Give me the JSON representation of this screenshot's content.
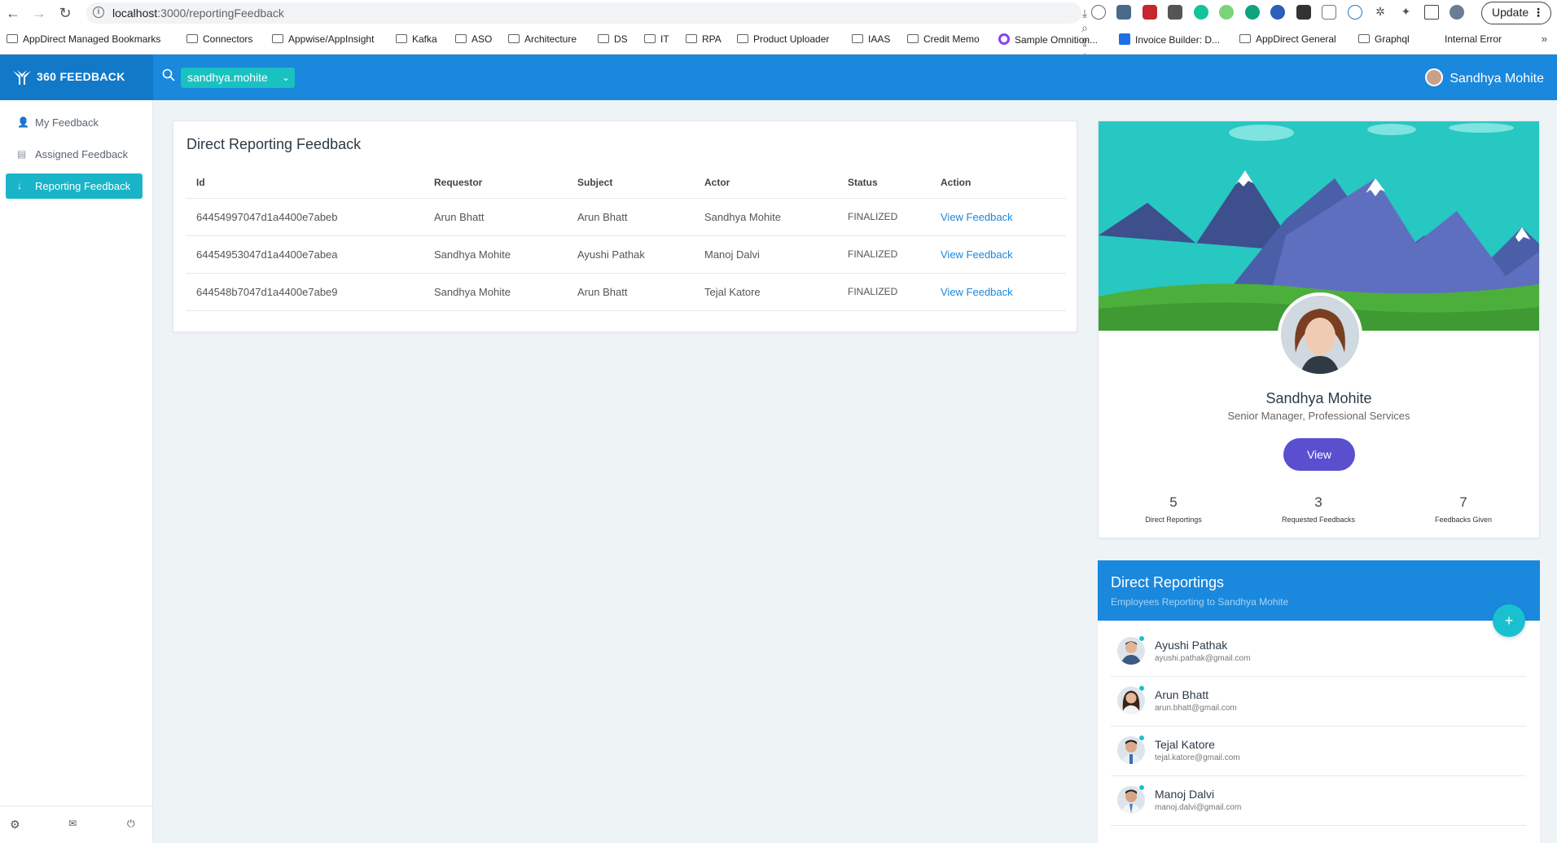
{
  "browser": {
    "url_host": "localhost",
    "url_path": ":3000/reportingFeedback",
    "update_label": "Update",
    "bookmarks": [
      {
        "label": "AppDirect Managed Bookmarks"
      },
      {
        "label": "Connectors"
      },
      {
        "label": "Appwise/AppInsight"
      },
      {
        "label": "Kafka"
      },
      {
        "label": "ASO"
      },
      {
        "label": "Architecture"
      },
      {
        "label": "DS"
      },
      {
        "label": "IT"
      },
      {
        "label": "RPA"
      },
      {
        "label": "Product Uploader"
      },
      {
        "label": "IAAS"
      },
      {
        "label": "Credit Memo"
      },
      {
        "label": "Sample Omnition..."
      },
      {
        "label": "Invoice Builder: D..."
      },
      {
        "label": "AppDirect General"
      },
      {
        "label": "Graphql"
      },
      {
        "label": "Internal Error"
      }
    ],
    "more": "»"
  },
  "header": {
    "brand": "360 FEEDBACK",
    "user_select": "sandhya.mohite",
    "current_user": "Sandhya Mohite"
  },
  "sidebar": {
    "items": [
      {
        "label": "My Feedback",
        "icon": "user-check-icon"
      },
      {
        "label": "Assigned Feedback",
        "icon": "clipboard-icon"
      },
      {
        "label": "Reporting Feedback",
        "icon": "arrow-down-icon"
      }
    ]
  },
  "feedback": {
    "title": "Direct Reporting Feedback",
    "columns": [
      "Id",
      "Requestor",
      "Subject",
      "Actor",
      "Status",
      "Action"
    ],
    "rows": [
      {
        "id": "64454997047d1a4400e7abeb",
        "requestor": "Arun Bhatt",
        "subject": "Arun Bhatt",
        "actor": "Sandhya Mohite",
        "status": "FINALIZED",
        "action": "View Feedback"
      },
      {
        "id": "64454953047d1a4400e7abea",
        "requestor": "Sandhya Mohite",
        "subject": "Ayushi Pathak",
        "actor": "Manoj Dalvi",
        "status": "FINALIZED",
        "action": "View Feedback"
      },
      {
        "id": "644548b7047d1a4400e7abe9",
        "requestor": "Sandhya Mohite",
        "subject": "Arun Bhatt",
        "actor": "Tejal Katore",
        "status": "FINALIZED",
        "action": "View Feedback"
      }
    ]
  },
  "profile": {
    "name": "Sandhya Mohite",
    "role": "Senior Manager, Professional Services",
    "view_label": "View",
    "stats": [
      {
        "value": "5",
        "label": "Direct Reportings"
      },
      {
        "value": "3",
        "label": "Requested Feedbacks"
      },
      {
        "value": "7",
        "label": "Feedbacks Given"
      }
    ]
  },
  "direct_reportings": {
    "title": "Direct Reportings",
    "subtitle": "Employees Reporting to Sandhya Mohite",
    "add_label": "+",
    "people": [
      {
        "name": "Ayushi Pathak",
        "email": "ayushi.pathak@gmail.com"
      },
      {
        "name": "Arun Bhatt",
        "email": "arun.bhatt@gmail.com"
      },
      {
        "name": "Tejal Katore",
        "email": "tejal.katore@gmail.com"
      },
      {
        "name": "Manoj Dalvi",
        "email": "manoj.dalvi@gmail.com"
      }
    ]
  },
  "colors": {
    "header_blue": "#1a88dc",
    "accent_teal": "#19b4c8",
    "button_purple": "#5a4fcf",
    "link_blue": "#1a88dc"
  }
}
